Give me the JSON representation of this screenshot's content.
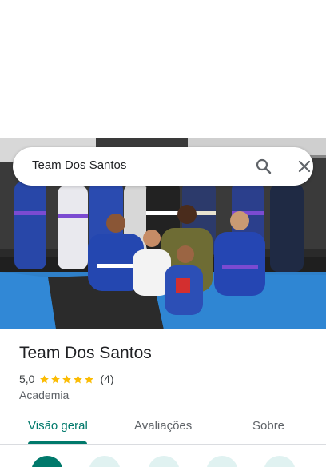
{
  "search": {
    "query": "Team Dos Santos"
  },
  "place": {
    "name": "Team Dos Santos",
    "rating": "5,0",
    "review_count": "(4)",
    "stars": 5,
    "category": "Academia"
  },
  "tabs": [
    {
      "label": "Visão geral",
      "active": true
    },
    {
      "label": "Avaliações",
      "active": false
    },
    {
      "label": "Sobre",
      "active": false
    }
  ],
  "colors": {
    "accent": "#00796b",
    "star": "#fbbc04",
    "mat_blue": "#2f80c9"
  },
  "icons": [
    "search-icon",
    "close-icon",
    "star-icon",
    "directions-icon",
    "save-icon",
    "nearby-icon",
    "send-icon",
    "share-icon"
  ]
}
